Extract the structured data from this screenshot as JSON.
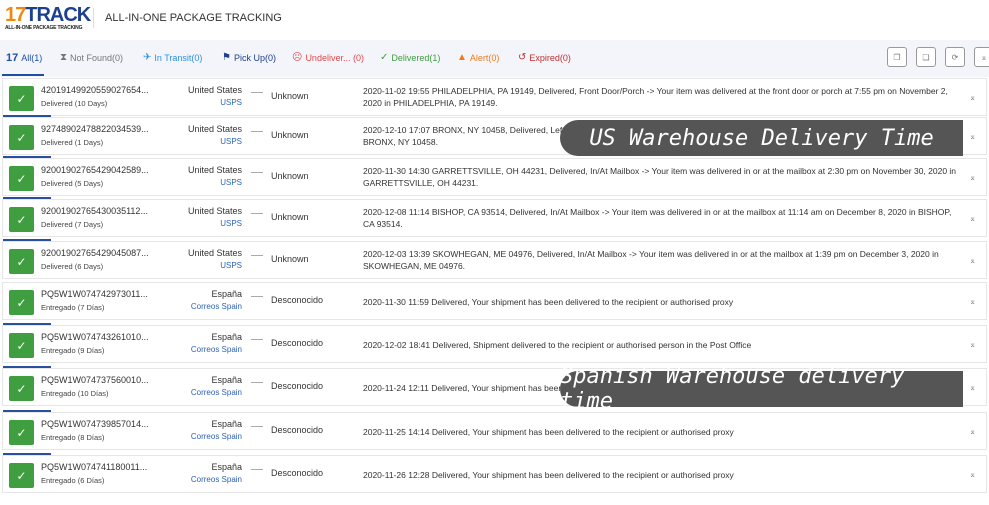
{
  "header": {
    "logo_main": "17TRACK",
    "logo_sub": "ALL-IN-ONE PACKAGE TRACKING",
    "title": "ALL-IN-ONE PACKAGE TRACKING"
  },
  "tabs": [
    {
      "label": "All(1)",
      "icon": "17-logo",
      "color": "#1d4fa8"
    },
    {
      "label": "Not Found(0)",
      "icon": "hourglass-icon",
      "color": "#777777"
    },
    {
      "label": "In Transit(0)",
      "icon": "plane-icon",
      "color": "#2d8fe0"
    },
    {
      "label": "Pick Up(0)",
      "icon": "flag-icon",
      "color": "#1d3f8f"
    },
    {
      "label": "Undeliver... (0)",
      "icon": "sad-face-icon",
      "color": "#e04848"
    },
    {
      "label": "Delivered(1)",
      "icon": "check-icon",
      "color": "#3f9e3f"
    },
    {
      "label": "Alert(0)",
      "icon": "warning-icon",
      "color": "#f07a1a"
    },
    {
      "label": "Expired(0)",
      "icon": "clock-history-icon",
      "color": "#c03030"
    }
  ],
  "toolbar": [
    "copy-icon",
    "copy-all-icon",
    "refresh-icon",
    "collapse-icon"
  ],
  "rows": [
    {
      "number": "42019149920559027654...",
      "status": "Delivered (10 Days)",
      "country": "United States",
      "carrier": "USPS",
      "dest": "Unknown",
      "msg": "2020-11-02 19:55  PHILADELPHIA, PA 19149, Delivered, Front Door/Porch -> Your item was delivered at the front door or porch at 7:55 pm on November 2, 2020 in PHILADELPHIA, PA 19149."
    },
    {
      "number": "92748902478822034539...",
      "status": "Delivered (1 Days)",
      "country": "United States",
      "carrier": "USPS",
      "dest": "Unknown",
      "msg": "2020-12-10 17:07  BRONX, NY 10458, Delivered, Left with individual -> Your item was delivered to an individual at the address at pm on December 10, 2020 in BRONX, NY 10458."
    },
    {
      "number": "92001902765429042589...",
      "status": "Delivered (5 Days)",
      "country": "United States",
      "carrier": "USPS",
      "dest": "Unknown",
      "msg": "2020-11-30 14:30  GARRETTSVILLE, OH 44231, Delivered, In/At Mailbox -> Your item was delivered in or at the mailbox at 2:30 pm on November 30, 2020 in GARRETTSVILLE, OH 44231."
    },
    {
      "number": "92001902765430035112...",
      "status": "Delivered (7 Days)",
      "country": "United States",
      "carrier": "USPS",
      "dest": "Unknown",
      "msg": "2020-12-08 11:14  BISHOP, CA 93514, Delivered, In/At Mailbox -> Your item was delivered in or at the mailbox at 11:14 am on December 8, 2020 in BISHOP, CA 93514."
    },
    {
      "number": "92001902765429045087...",
      "status": "Delivered (6 Days)",
      "country": "United States",
      "carrier": "USPS",
      "dest": "Unknown",
      "msg": "2020-12-03 13:39  SKOWHEGAN, ME 04976, Delivered, In/At Mailbox -> Your item was delivered in or at the mailbox at 1:39 pm on December 3, 2020 in SKOWHEGAN, ME 04976."
    },
    {
      "number": "PQ5W1W074742973011...",
      "status": "Entregado (7 Días)",
      "country": "España",
      "carrier": "Correos Spain",
      "dest": "Desconocido",
      "msg": "2020-11-30 11:59  Delivered, Your shipment has been delivered to the recipient or authorised proxy"
    },
    {
      "number": "PQ5W1W074743261010...",
      "status": "Entregado (9 Días)",
      "country": "España",
      "carrier": "Correos Spain",
      "dest": "Desconocido",
      "msg": "2020-12-02 18:41  Delivered, Shipment delivered to the recipient or authorised person in the Post Office"
    },
    {
      "number": "PQ5W1W074737560010...",
      "status": "Entregado (10 Días)",
      "country": "España",
      "carrier": "Correos Spain",
      "dest": "Desconocido",
      "msg": "2020-11-24 12:11  Delivered, Your shipment has been delivered to the recipient or authorised proxy"
    },
    {
      "number": "PQ5W1W074739857014...",
      "status": "Entregado (8 Días)",
      "country": "España",
      "carrier": "Correos Spain",
      "dest": "Desconocido",
      "msg": "2020-11-25 14:14  Delivered, Your shipment has been delivered to the recipient or authorised proxy"
    },
    {
      "number": "PQ5W1W074741180011...",
      "status": "Entregado (6 Días)",
      "country": "España",
      "carrier": "Correos Spain",
      "dest": "Desconocido",
      "msg": "2020-11-26 12:28  Delivered, Your shipment has been delivered to the recipient or authorised proxy"
    }
  ],
  "overlays": {
    "us": "US Warehouse Delivery Time",
    "spain": "Spanish Warehouse delivery time"
  }
}
